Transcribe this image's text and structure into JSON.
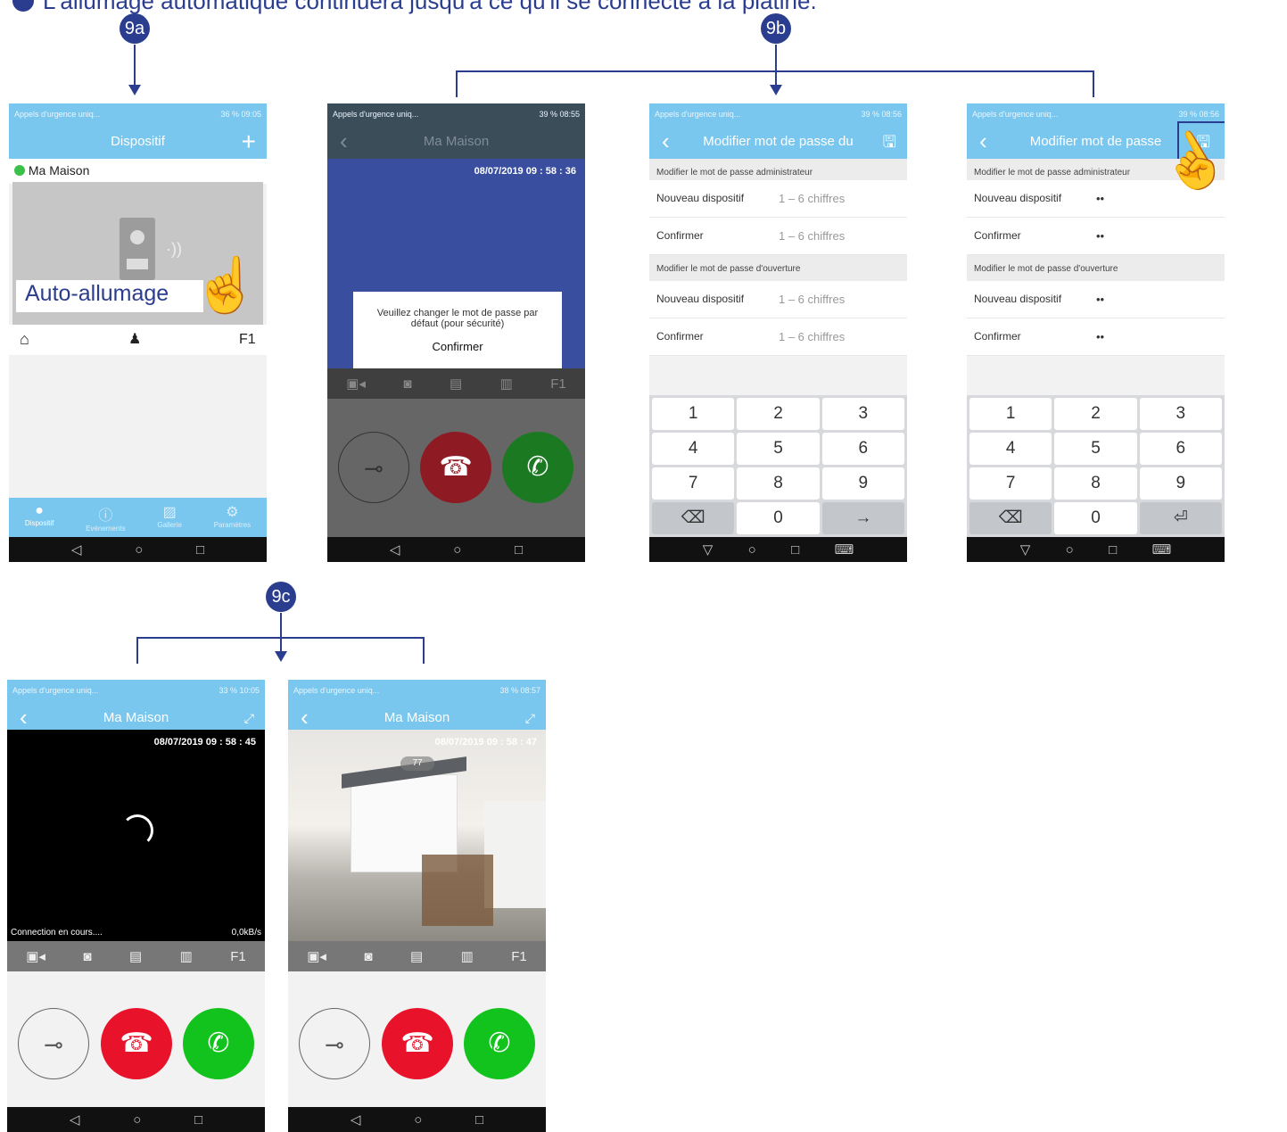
{
  "heading": "L'allumage automatique continuera jusqu'à ce qu'il se connecte à la platine.",
  "steps": {
    "a": "9a",
    "b": "9b",
    "c": "9c"
  },
  "status": {
    "carrier": "Appels d'urgence uniq...",
    "s1": "36 % 09:05",
    "s2": "39 % 08:55",
    "s3": "39 % 08:56",
    "s4": "39 % 08:56",
    "s5": "33 % 10:05",
    "s6": "38 % 08:57"
  },
  "screen1": {
    "title": "Dispositif",
    "add": "+",
    "device": "Ma Maison",
    "overlay": "Auto-allumage",
    "f1": "F1",
    "tabs": [
      "Dispositif",
      "Evénements",
      "Gallerie",
      "Paramètres"
    ]
  },
  "screen2": {
    "title": "Ma Maison",
    "timestamp": "08/07/2019  09 : 58 : 36",
    "dialog": "Veuillez changer le mot de passe par défaut (pour sécurité)",
    "confirm": "Confirmer",
    "f1": "F1"
  },
  "screen3": {
    "title": "Modifier mot de passe du",
    "sec1": "Modifier le mot de passe administrateur",
    "sec2": "Modifier le mot de passe d'ouverture",
    "r1": "Nouveau dispositif",
    "r2": "Confirmer",
    "r3": "Nouveau dispositif",
    "r4": "Confirmer",
    "hint": "1 – 6 chiffres",
    "keys": [
      "1",
      "2",
      "3",
      "4",
      "5",
      "6",
      "7",
      "8",
      "9",
      "⌫",
      "0",
      "→"
    ]
  },
  "screen4": {
    "title": "Modifier mot de passe",
    "sec1": "Modifier le mot de passe administrateur",
    "sec2": "Modifier le mot de passe d'ouverture",
    "r1": "Nouveau dispositif",
    "r2": "Confirmer",
    "r3": "Nouveau dispositif",
    "r4": "Confirmer",
    "dots": "••",
    "keys": [
      "1",
      "2",
      "3",
      "4",
      "5",
      "6",
      "7",
      "8",
      "9",
      "⌫",
      "0",
      "⏎"
    ]
  },
  "screen5": {
    "title": "Ma Maison",
    "timestamp": "08/07/2019  09 : 58 : 45",
    "connecting": "Connection en cours....",
    "rate": "0,0kB/s",
    "f1": "F1"
  },
  "screen6": {
    "title": "Ma Maison",
    "timestamp": "08/07/2019  09 : 58 : 47",
    "badge": "77",
    "f1": "F1"
  }
}
